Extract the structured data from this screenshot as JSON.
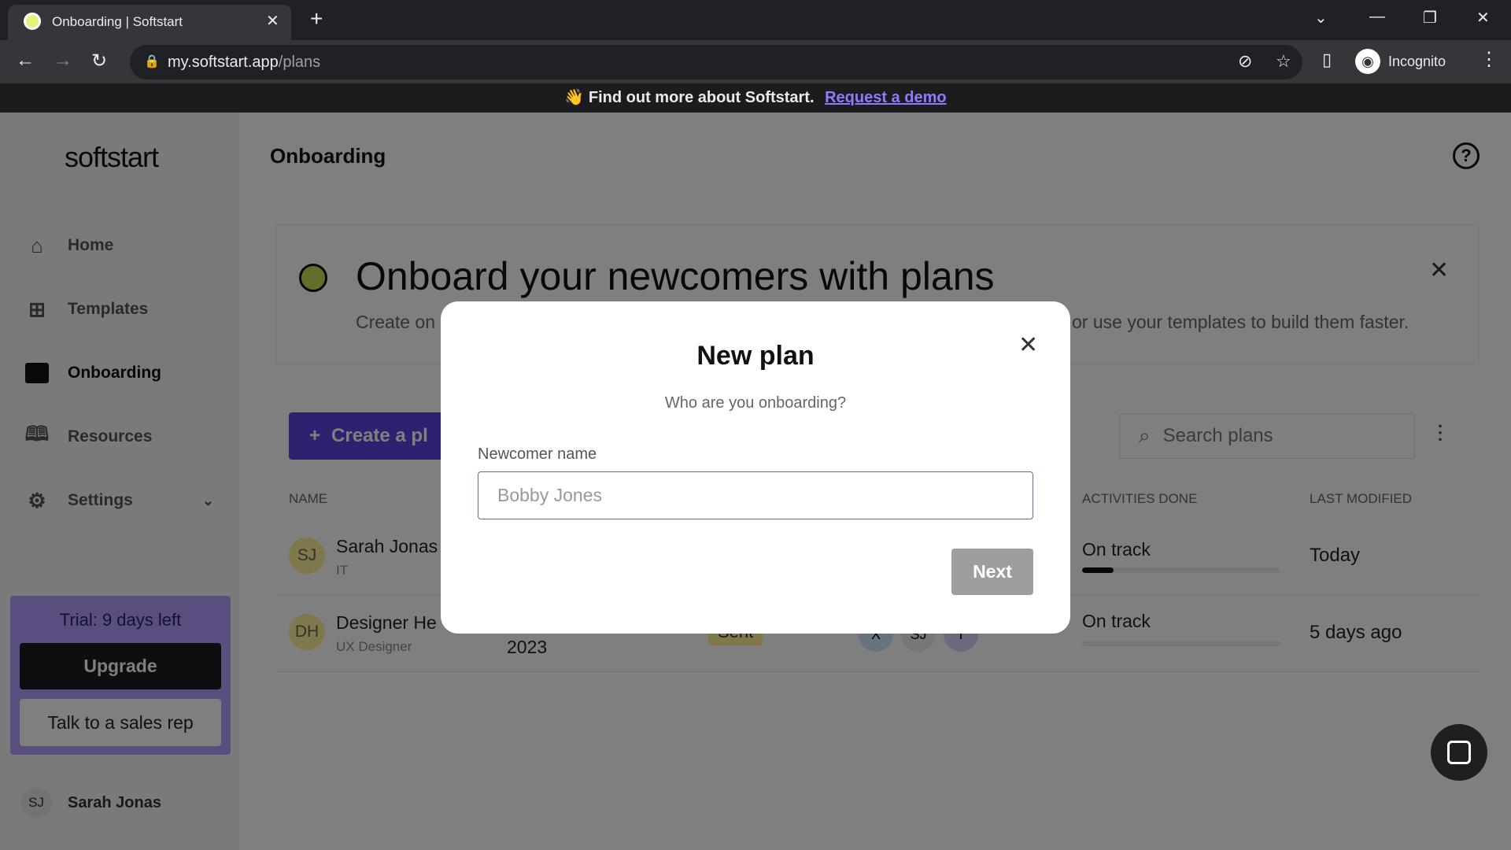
{
  "browser": {
    "tab_title": "Onboarding | Softstart",
    "url_host": "my.softstart.app",
    "url_path": "/plans",
    "profile": "Incognito"
  },
  "banner": {
    "text": "Find out more about Softstart.",
    "link": "Request a demo"
  },
  "sidebar": {
    "logo": "softstart",
    "items": [
      {
        "label": "Home",
        "icon": "home-icon"
      },
      {
        "label": "Templates",
        "icon": "templates-icon"
      },
      {
        "label": "Onboarding",
        "icon": "calendar-icon",
        "active": true
      },
      {
        "label": "Resources",
        "icon": "book-icon"
      },
      {
        "label": "Settings",
        "icon": "gear-icon"
      }
    ],
    "trial": {
      "text": "Trial: 9 days left",
      "upgrade": "Upgrade",
      "sales": "Talk to a sales rep"
    },
    "user": {
      "initials": "SJ",
      "name": "Sarah Jonas"
    }
  },
  "header": {
    "title": "Onboarding"
  },
  "card": {
    "title": "Onboard your newcomers with plans",
    "subtitle_start": "Create on",
    "subtitle_end": "or use your templates to build them faster."
  },
  "toolbar": {
    "create": "Create a pl",
    "search_placeholder": "Search plans"
  },
  "table": {
    "headers": {
      "name": "NAME",
      "activities": "ACTIVITIES DONE",
      "modified": "LAST MODIFIED"
    },
    "rows": [
      {
        "initials": "SJ",
        "name": "Sarah Jonas",
        "role": "IT",
        "status": "On track",
        "progress": 0.16,
        "modified": "Today"
      },
      {
        "initials": "DH",
        "name": "Designer He",
        "role": "UX Designer",
        "date": "2023",
        "badge": "Sent",
        "avatars": [
          "X",
          "SJ",
          "T"
        ],
        "status": "On track",
        "progress": 0,
        "modified": "5 days ago"
      }
    ]
  },
  "modal": {
    "title": "New plan",
    "subtitle": "Who are you onboarding?",
    "label": "Newcomer name",
    "placeholder": "Bobby Jones",
    "next": "Next"
  }
}
